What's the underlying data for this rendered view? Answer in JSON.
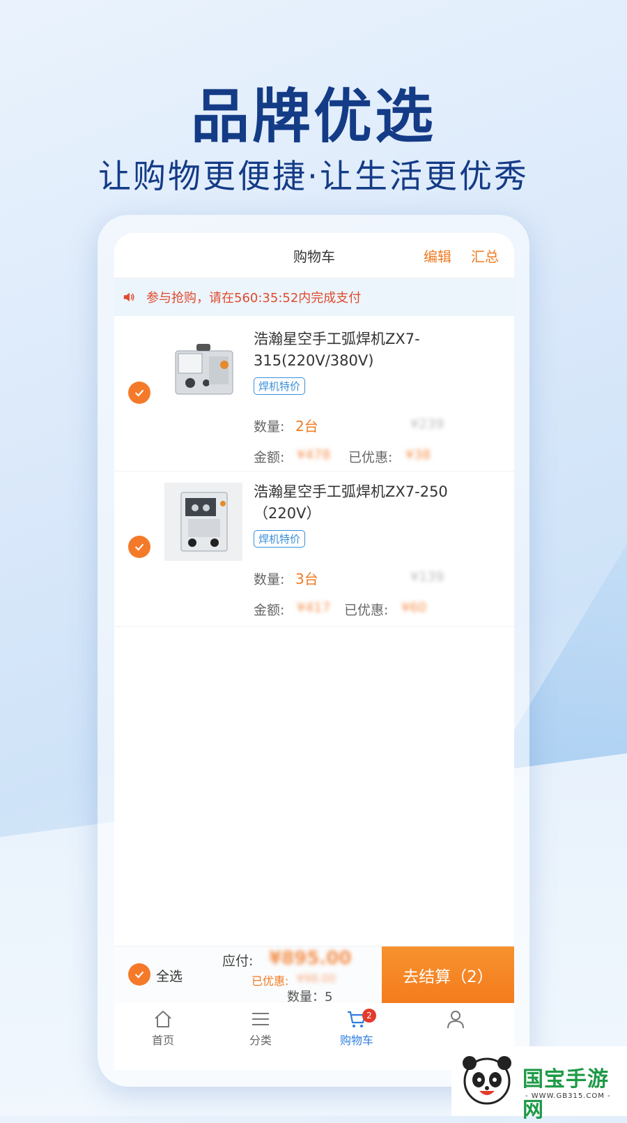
{
  "headline": "品牌优选",
  "subline": "让购物更便捷·让生活更优秀",
  "cart": {
    "title": "购物车",
    "edit_label": "编辑",
    "summary_label": "汇总",
    "notice": "参与抢购，请在560:35:52内完成支付",
    "items": [
      {
        "name": "浩瀚星空手工弧焊机ZX7-315(220V/380V)",
        "tag": "焊机特价",
        "qty_label": "数量:",
        "qty": "2台",
        "unit_price": "¥239",
        "amount_label": "金额:",
        "amount": "¥478",
        "discount_label": "已优惠:",
        "discount": "¥38",
        "checked": true
      },
      {
        "name": "浩瀚星空手工弧焊机ZX7-250（220V）",
        "tag": "焊机特价",
        "qty_label": "数量:",
        "qty": "3台",
        "unit_price": "¥139",
        "amount_label": "金额:",
        "amount": "¥417",
        "discount_label": "已优惠:",
        "discount": "¥60",
        "checked": true
      }
    ],
    "footer": {
      "select_all": "全选",
      "payable_label": "应付:",
      "payable": "¥895.00",
      "discount_label": "已优惠:",
      "discount": "¥98.00",
      "count_label": "数量：5",
      "checkout": "去结算（2）"
    }
  },
  "tabbar": {
    "items": [
      {
        "label": "首页",
        "icon": "home-icon"
      },
      {
        "label": "分类",
        "icon": "menu-icon"
      },
      {
        "label": "购物车",
        "icon": "cart-icon",
        "badge": "2",
        "active": true
      },
      {
        "label": "",
        "icon": "user-icon"
      }
    ]
  },
  "watermark": {
    "brand": "国宝手游网",
    "url": "- WWW.GB315.COM -"
  },
  "colors": {
    "accent": "#f47a2a",
    "headline": "#143b86",
    "link_active": "#2d7ee0",
    "notice_text": "#e04a2e"
  }
}
